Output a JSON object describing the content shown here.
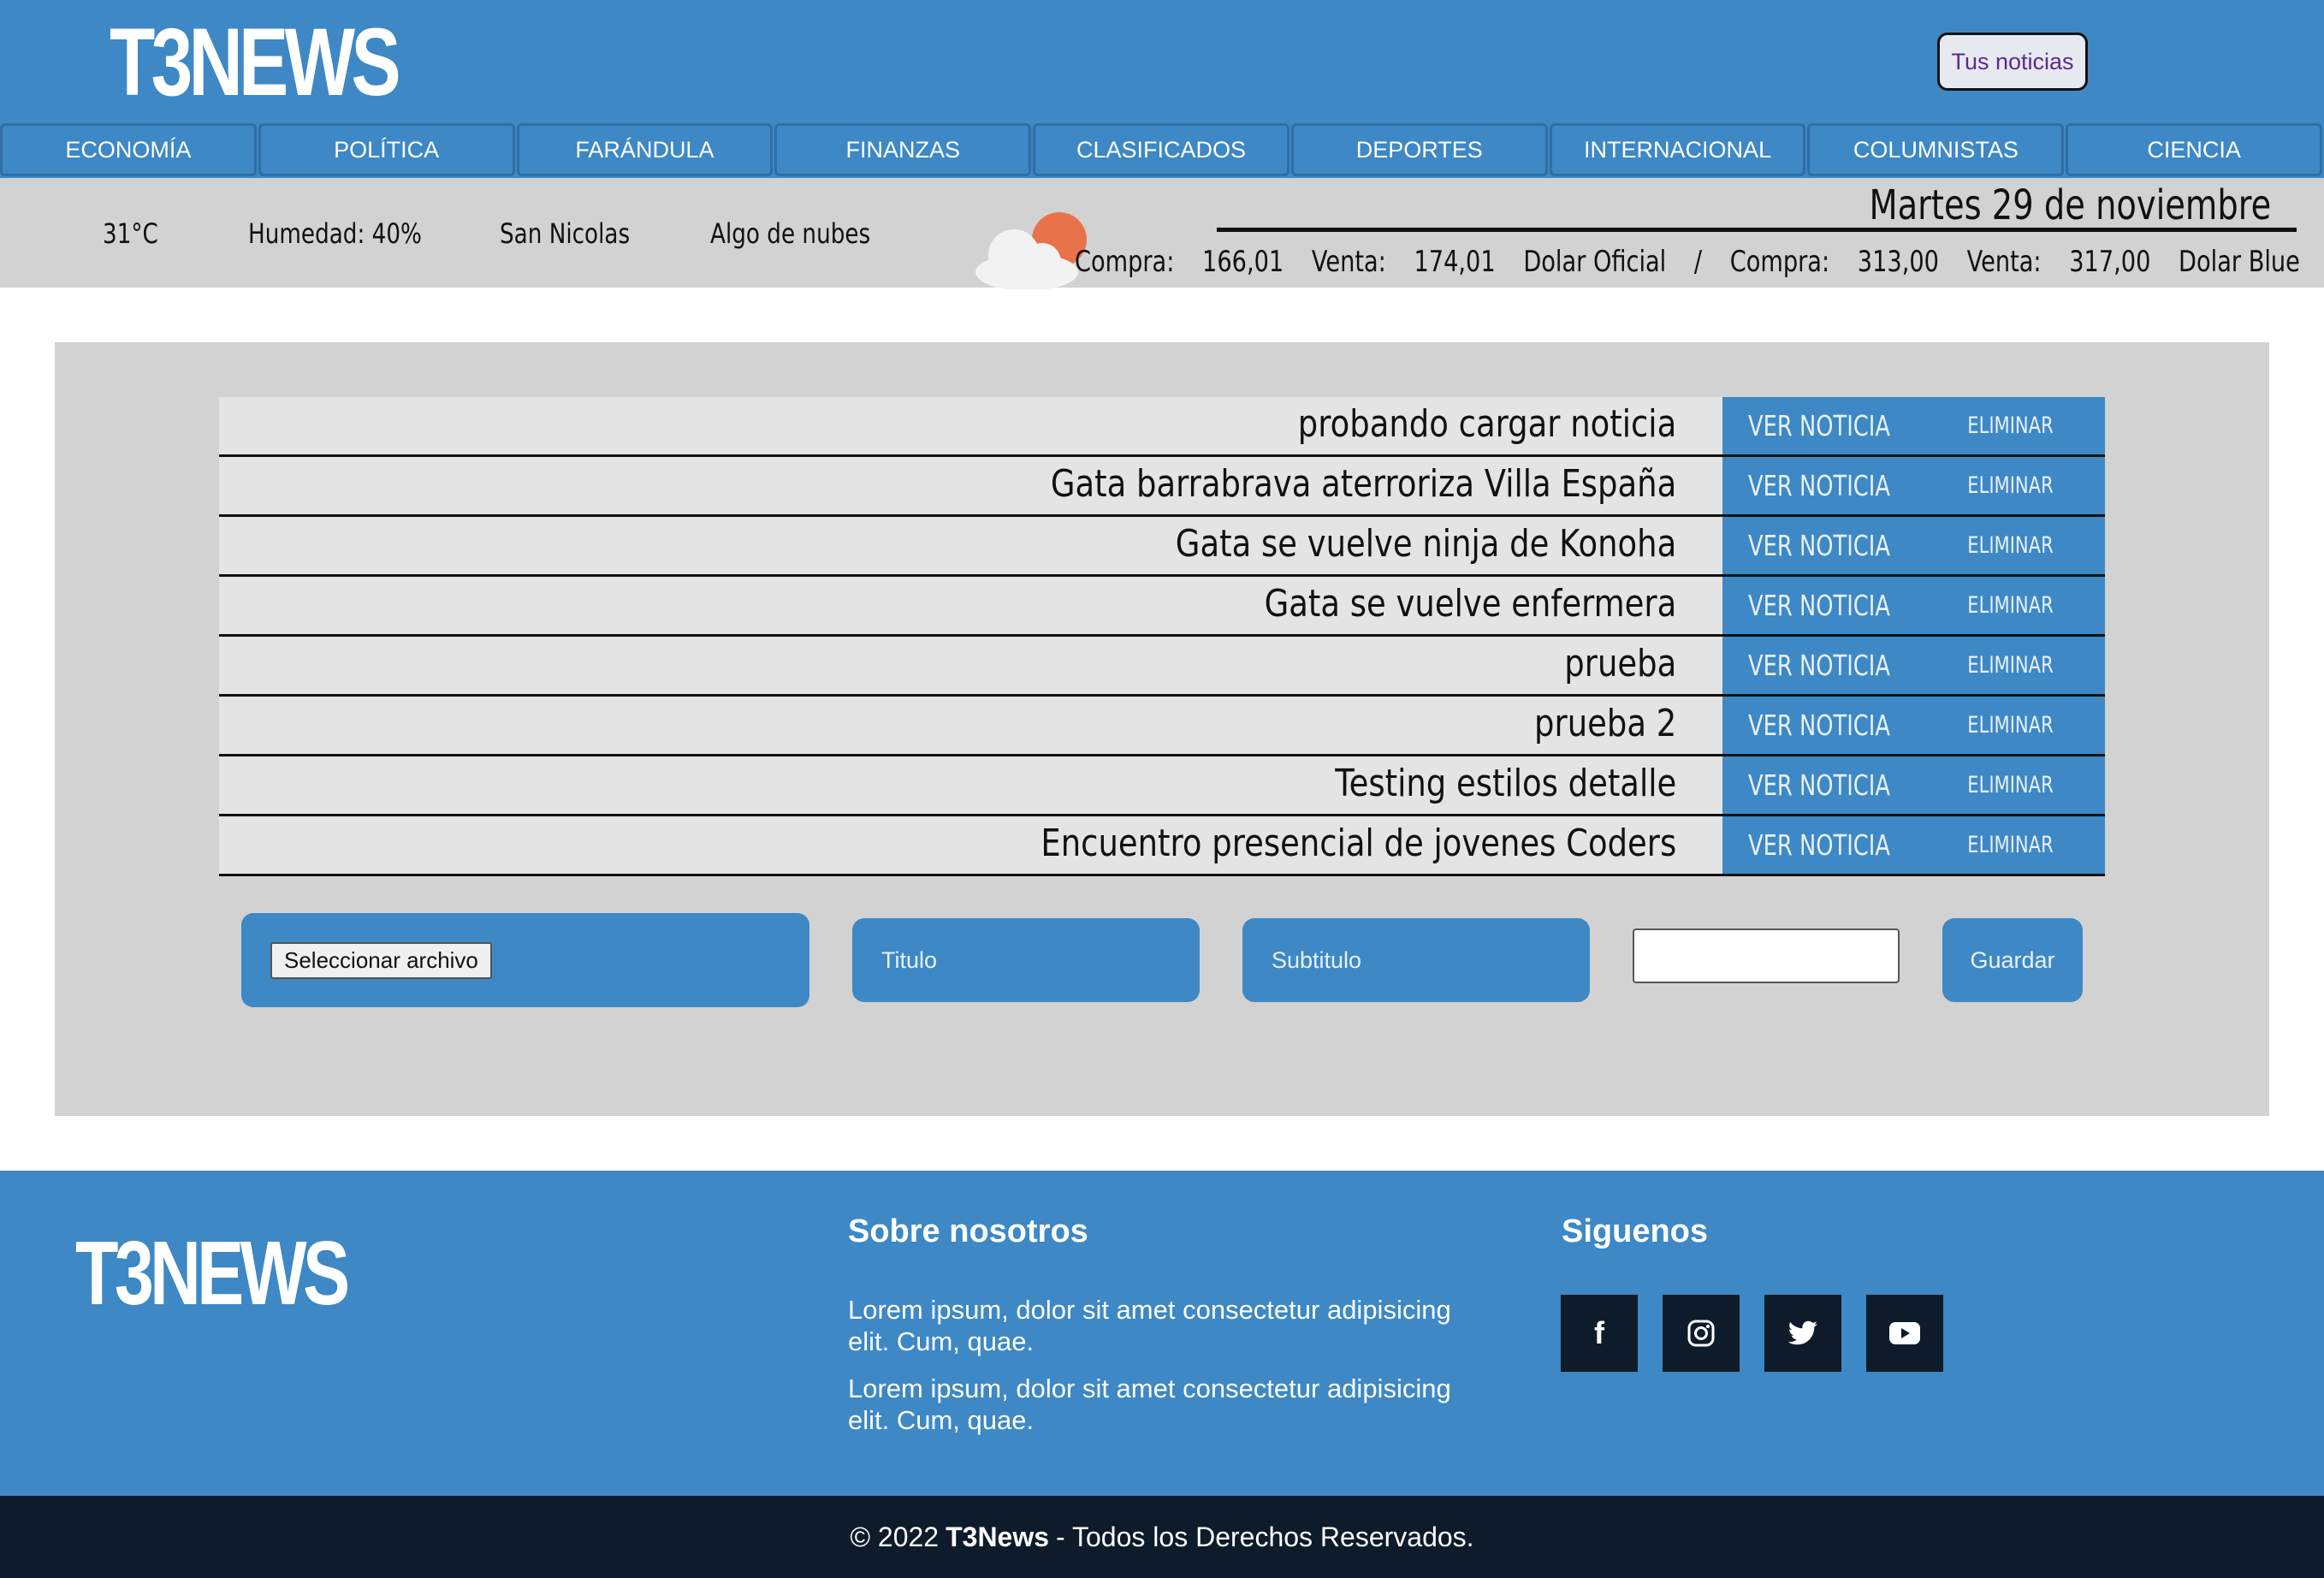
{
  "header": {
    "logo": "T3NEWS",
    "tus_noticias": "Tus noticias",
    "nav": [
      "ECONOMÍA",
      "POLÍTICA",
      "FARÁNDULA",
      "FINANZAS",
      "CLASIFICADOS",
      "DEPORTES",
      "INTERNACIONAL",
      "COLUMNISTAS",
      "CIENCIA"
    ]
  },
  "weather": {
    "temperature": "31°C",
    "humidity": "Humedad: 40%",
    "city": "San Nicolas",
    "condition": "Algo de nubes",
    "icon": "partly-cloudy-icon"
  },
  "date": "Martes 29 de noviembre",
  "rates": {
    "oficial": {
      "compra_label": "Compra:",
      "compra": "166,01",
      "venta_label": "Venta:",
      "venta": "174,01",
      "name": "Dolar Oficial"
    },
    "separator": "/",
    "blue": {
      "compra_label": "Compra:",
      "compra": "313,00",
      "venta_label": "Venta:",
      "venta": "317,00",
      "name": "Dolar Blue"
    }
  },
  "news": {
    "ver_label": "VER NOTICIA",
    "eliminar_label": "ELIMINAR",
    "items": [
      "probando cargar noticia",
      "Gata barrabrava aterroriza Villa España",
      "Gata se vuelve ninja de Konoha",
      "Gata se vuelve enfermera",
      "prueba",
      "prueba 2",
      "Testing estilos detalle",
      "Encuentro presencial de jovenes Coders"
    ]
  },
  "form": {
    "file_button": "Seleccionar archivo",
    "titulo_placeholder": "Titulo",
    "subtitulo_placeholder": "Subtitulo",
    "guardar": "Guardar"
  },
  "footer": {
    "logo": "T3NEWS",
    "about_title": "Sobre nosotros",
    "about_p1": "Lorem ipsum, dolor sit amet consectetur adipisicing elit. Cum, quae.",
    "about_p2": "Lorem ipsum, dolor sit amet consectetur adipisicing elit. Cum, quae.",
    "social_title": "Siguenos",
    "social_icons": [
      "facebook-icon",
      "instagram-icon",
      "twitter-icon",
      "youtube-icon"
    ],
    "copyright_prefix": "© 2022",
    "copyright_brand": "T3News",
    "copyright_suffix": "- Todos los Derechos Reservados."
  },
  "colors": {
    "brand_blue": "#3d88c5",
    "dark_navy": "#0d1b2a",
    "panel_gray": "#d2d2d2"
  }
}
